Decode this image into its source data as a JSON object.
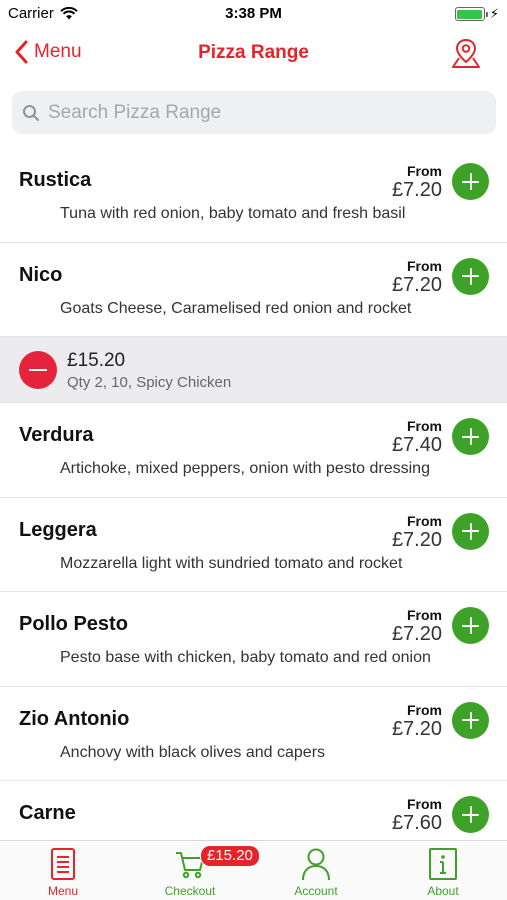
{
  "status": {
    "carrier": "Carrier",
    "time": "3:38 PM",
    "battery_level": 1.0
  },
  "nav": {
    "back_label": "Menu",
    "title": "Pizza Range"
  },
  "search": {
    "placeholder": "Search Pizza Range"
  },
  "from_label": "From",
  "items": [
    {
      "name": "Rustica",
      "description": "Tuna with red onion, baby tomato and fresh basil",
      "price": "£7.20"
    },
    {
      "name": "Nico",
      "description": "Goats Cheese, Caramelised red onion and rocket",
      "price": "£7.20"
    },
    {
      "name": "Verdura",
      "description": "Artichoke, mixed peppers, onion with pesto dressing",
      "price": "£7.40"
    },
    {
      "name": "Leggera",
      "description": "Mozzarella light with sundried tomato and rocket",
      "price": "£7.20"
    },
    {
      "name": "Pollo Pesto",
      "description": "Pesto base with chicken, baby tomato and red onion",
      "price": "£7.20"
    },
    {
      "name": "Zio Antonio",
      "description": "Anchovy with black olives and capers",
      "price": "£7.20"
    },
    {
      "name": "Carne",
      "description": "",
      "price": "£7.60"
    }
  ],
  "basket_line": {
    "price": "£15.20",
    "detail": "Qty 2, 10, Spicy Chicken"
  },
  "tabs": [
    {
      "label": "Menu",
      "active": true
    },
    {
      "label": "Checkout",
      "badge": "£15.20"
    },
    {
      "label": "Account"
    },
    {
      "label": "About"
    }
  ],
  "colors": {
    "accent": "#e5232a",
    "add": "#3fa228",
    "remove": "#e5233c"
  }
}
